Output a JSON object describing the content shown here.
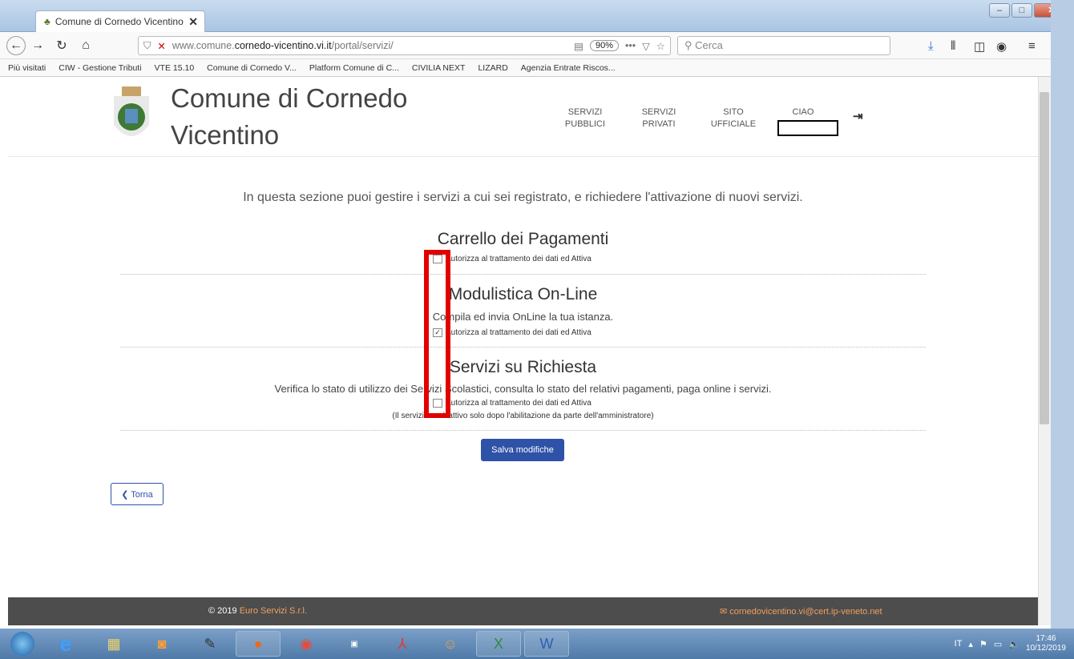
{
  "browser": {
    "tab_title": "Comune di Cornedo Vicentino",
    "tab_close": "✕",
    "url_prefix": "www.comune.",
    "url_domain": "cornedo-vicentino.vi.it",
    "url_path": "/portal/servizi/",
    "zoom": "90%",
    "search_placeholder": "Cerca",
    "bookmarks": [
      "Più visitati",
      "CIW - Gestione Tributi",
      "VTE 15.10",
      "Comune di Cornedo V...",
      "Platform Comune di C...",
      "CIVILIA NEXT",
      "LIZARD",
      "Agenzia Entrate Riscos..."
    ]
  },
  "site": {
    "name_line1": "Comune di Cornedo",
    "name_line2": "Vicentino",
    "menu": [
      {
        "l1": "SERVIZI",
        "l2": "PUBBLICI"
      },
      {
        "l1": "SERVIZI",
        "l2": "PRIVATI"
      },
      {
        "l1": "SITO",
        "l2": "UFFICIALE"
      },
      {
        "l1": "CIAO",
        "l2": ""
      }
    ]
  },
  "intro": "In questa sezione puoi gestire i servizi a cui sei registrato, e richiedere l'attivazione di nuovi servizi.",
  "services": [
    {
      "title": "Carrello dei Pagamenti",
      "desc": "",
      "checkbox_label": "Autorizza al trattamento dei dati ed Attiva",
      "checked": false
    },
    {
      "title": "Modulistica On-Line",
      "desc": "Compila ed invia OnLine la tua istanza.",
      "checkbox_label": "Autorizza al trattamento dei dati ed Attiva",
      "checked": true
    },
    {
      "title": "Servizi su Richiesta",
      "desc": "Verifica lo stato di utilizzo dei Servizi Scolastici, consulta lo stato del relativi pagamenti, paga online i servizi.",
      "checkbox_label": "Autorizza al trattamento dei dati ed Attiva",
      "checked": false
    }
  ],
  "note": "(Il servizio sarà attivo solo dopo l'abilitazione da parte dell'amministratore)",
  "save_label": "Salva modifiche",
  "back_label": "Torna",
  "footer": {
    "copyright": "© 2019 ",
    "company": "Euro Servizi S.r.l.",
    "email": "cornedovicentino.vi@cert.ip-veneto.net"
  },
  "taskbar": {
    "lang": "IT",
    "time": "17:46",
    "date": "10/12/2019"
  }
}
